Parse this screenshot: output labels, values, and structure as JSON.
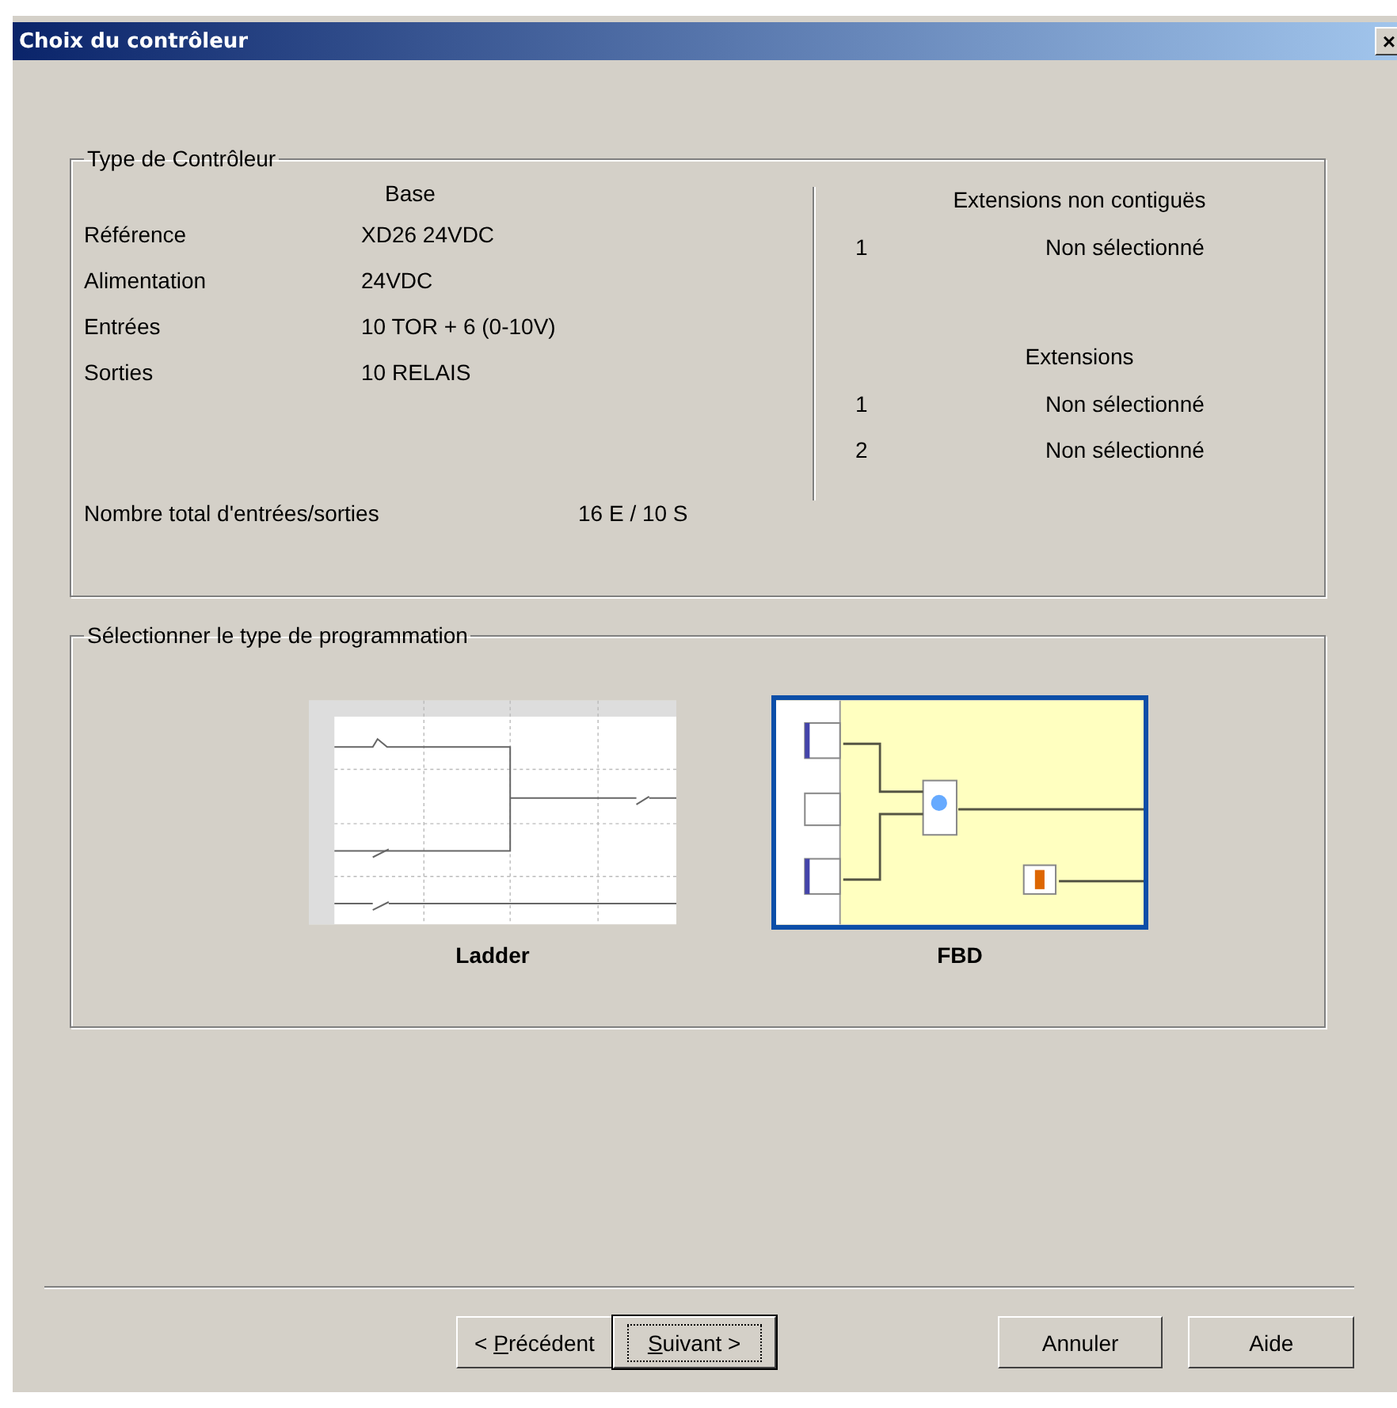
{
  "window": {
    "title": "Choix du contrôleur",
    "close": "×"
  },
  "controller_type": {
    "title": "Type de Contrôleur",
    "base_heading": "Base",
    "rows": [
      {
        "label": "Référence",
        "value": "XD26 24VDC"
      },
      {
        "label": "Alimentation",
        "value": "24VDC"
      },
      {
        "label": "Entrées",
        "value": "10 TOR + 6 (0-10V)"
      },
      {
        "label": "Sorties",
        "value": "10 RELAIS"
      }
    ],
    "total": {
      "label": "Nombre total d'entrées/sorties",
      "value": "16 E / 10 S"
    },
    "noncontiguous": {
      "heading": "Extensions non contiguës",
      "items": [
        {
          "index": "1",
          "value": "Non sélectionné"
        }
      ]
    },
    "extensions": {
      "heading": "Extensions",
      "items": [
        {
          "index": "1",
          "value": "Non sélectionné"
        },
        {
          "index": "2",
          "value": "Non sélectionné"
        }
      ]
    }
  },
  "programming": {
    "title": "Sélectionner le type de programmation",
    "options": [
      {
        "kind": "ladder",
        "label": "Ladder",
        "selected": false
      },
      {
        "kind": "fbd",
        "label": "FBD",
        "selected": true
      }
    ]
  },
  "buttons": [
    {
      "prefix": "< ",
      "key": "P",
      "rest": "récédent",
      "default": false
    },
    {
      "key": "S",
      "rest": "uivant >",
      "default": true
    },
    {
      "rest": "Annuler",
      "default": false
    },
    {
      "rest": "Aide",
      "default": false
    }
  ]
}
